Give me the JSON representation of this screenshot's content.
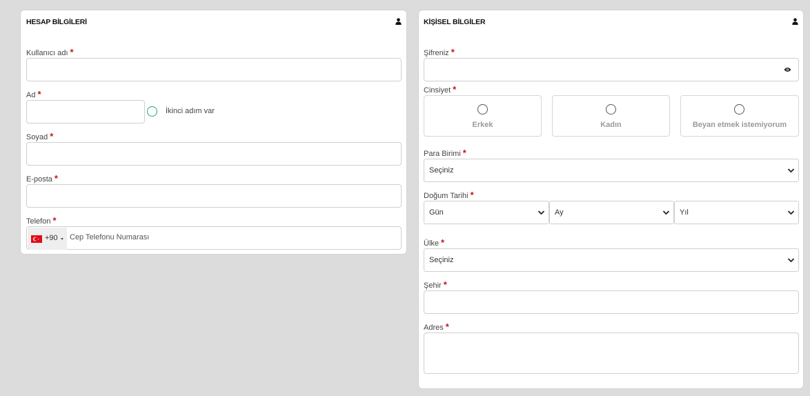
{
  "account": {
    "title": "HESAP BİLGİLERİ",
    "icon": "user-icon",
    "username_label": "Kullanıcı adı",
    "first_name_label": "Ad",
    "second_name_option": "İkinci adım var",
    "last_name_label": "Soyad",
    "email_label": "E-posta",
    "phone_label": "Telefon",
    "phone_dial_code": "+90",
    "phone_placeholder": "Cep Telefonu Numarası",
    "required_mark": "*"
  },
  "personal": {
    "title": "KİŞİSEL BİLGİLER",
    "icon": "user-icon",
    "password_label": "Şifreniz",
    "gender_label": "Cinsiyet",
    "gender_options": [
      "Erkek",
      "Kadın",
      "Beyan etmek istemiyorum"
    ],
    "currency_label": "Para Birimi",
    "currency_value": "Seçiniz",
    "birth_label": "Doğum Tarihi",
    "birth_day": "Gün",
    "birth_month": "Ay",
    "birth_year": "Yıl",
    "country_label": "Ülke",
    "country_value": "Seçiniz",
    "city_label": "Şehir",
    "address_label": "Adres",
    "required_mark": "*"
  },
  "colors": {
    "required": "#c0161e",
    "radio_accent": "#2ba47a",
    "background": "#dcdcdc"
  }
}
